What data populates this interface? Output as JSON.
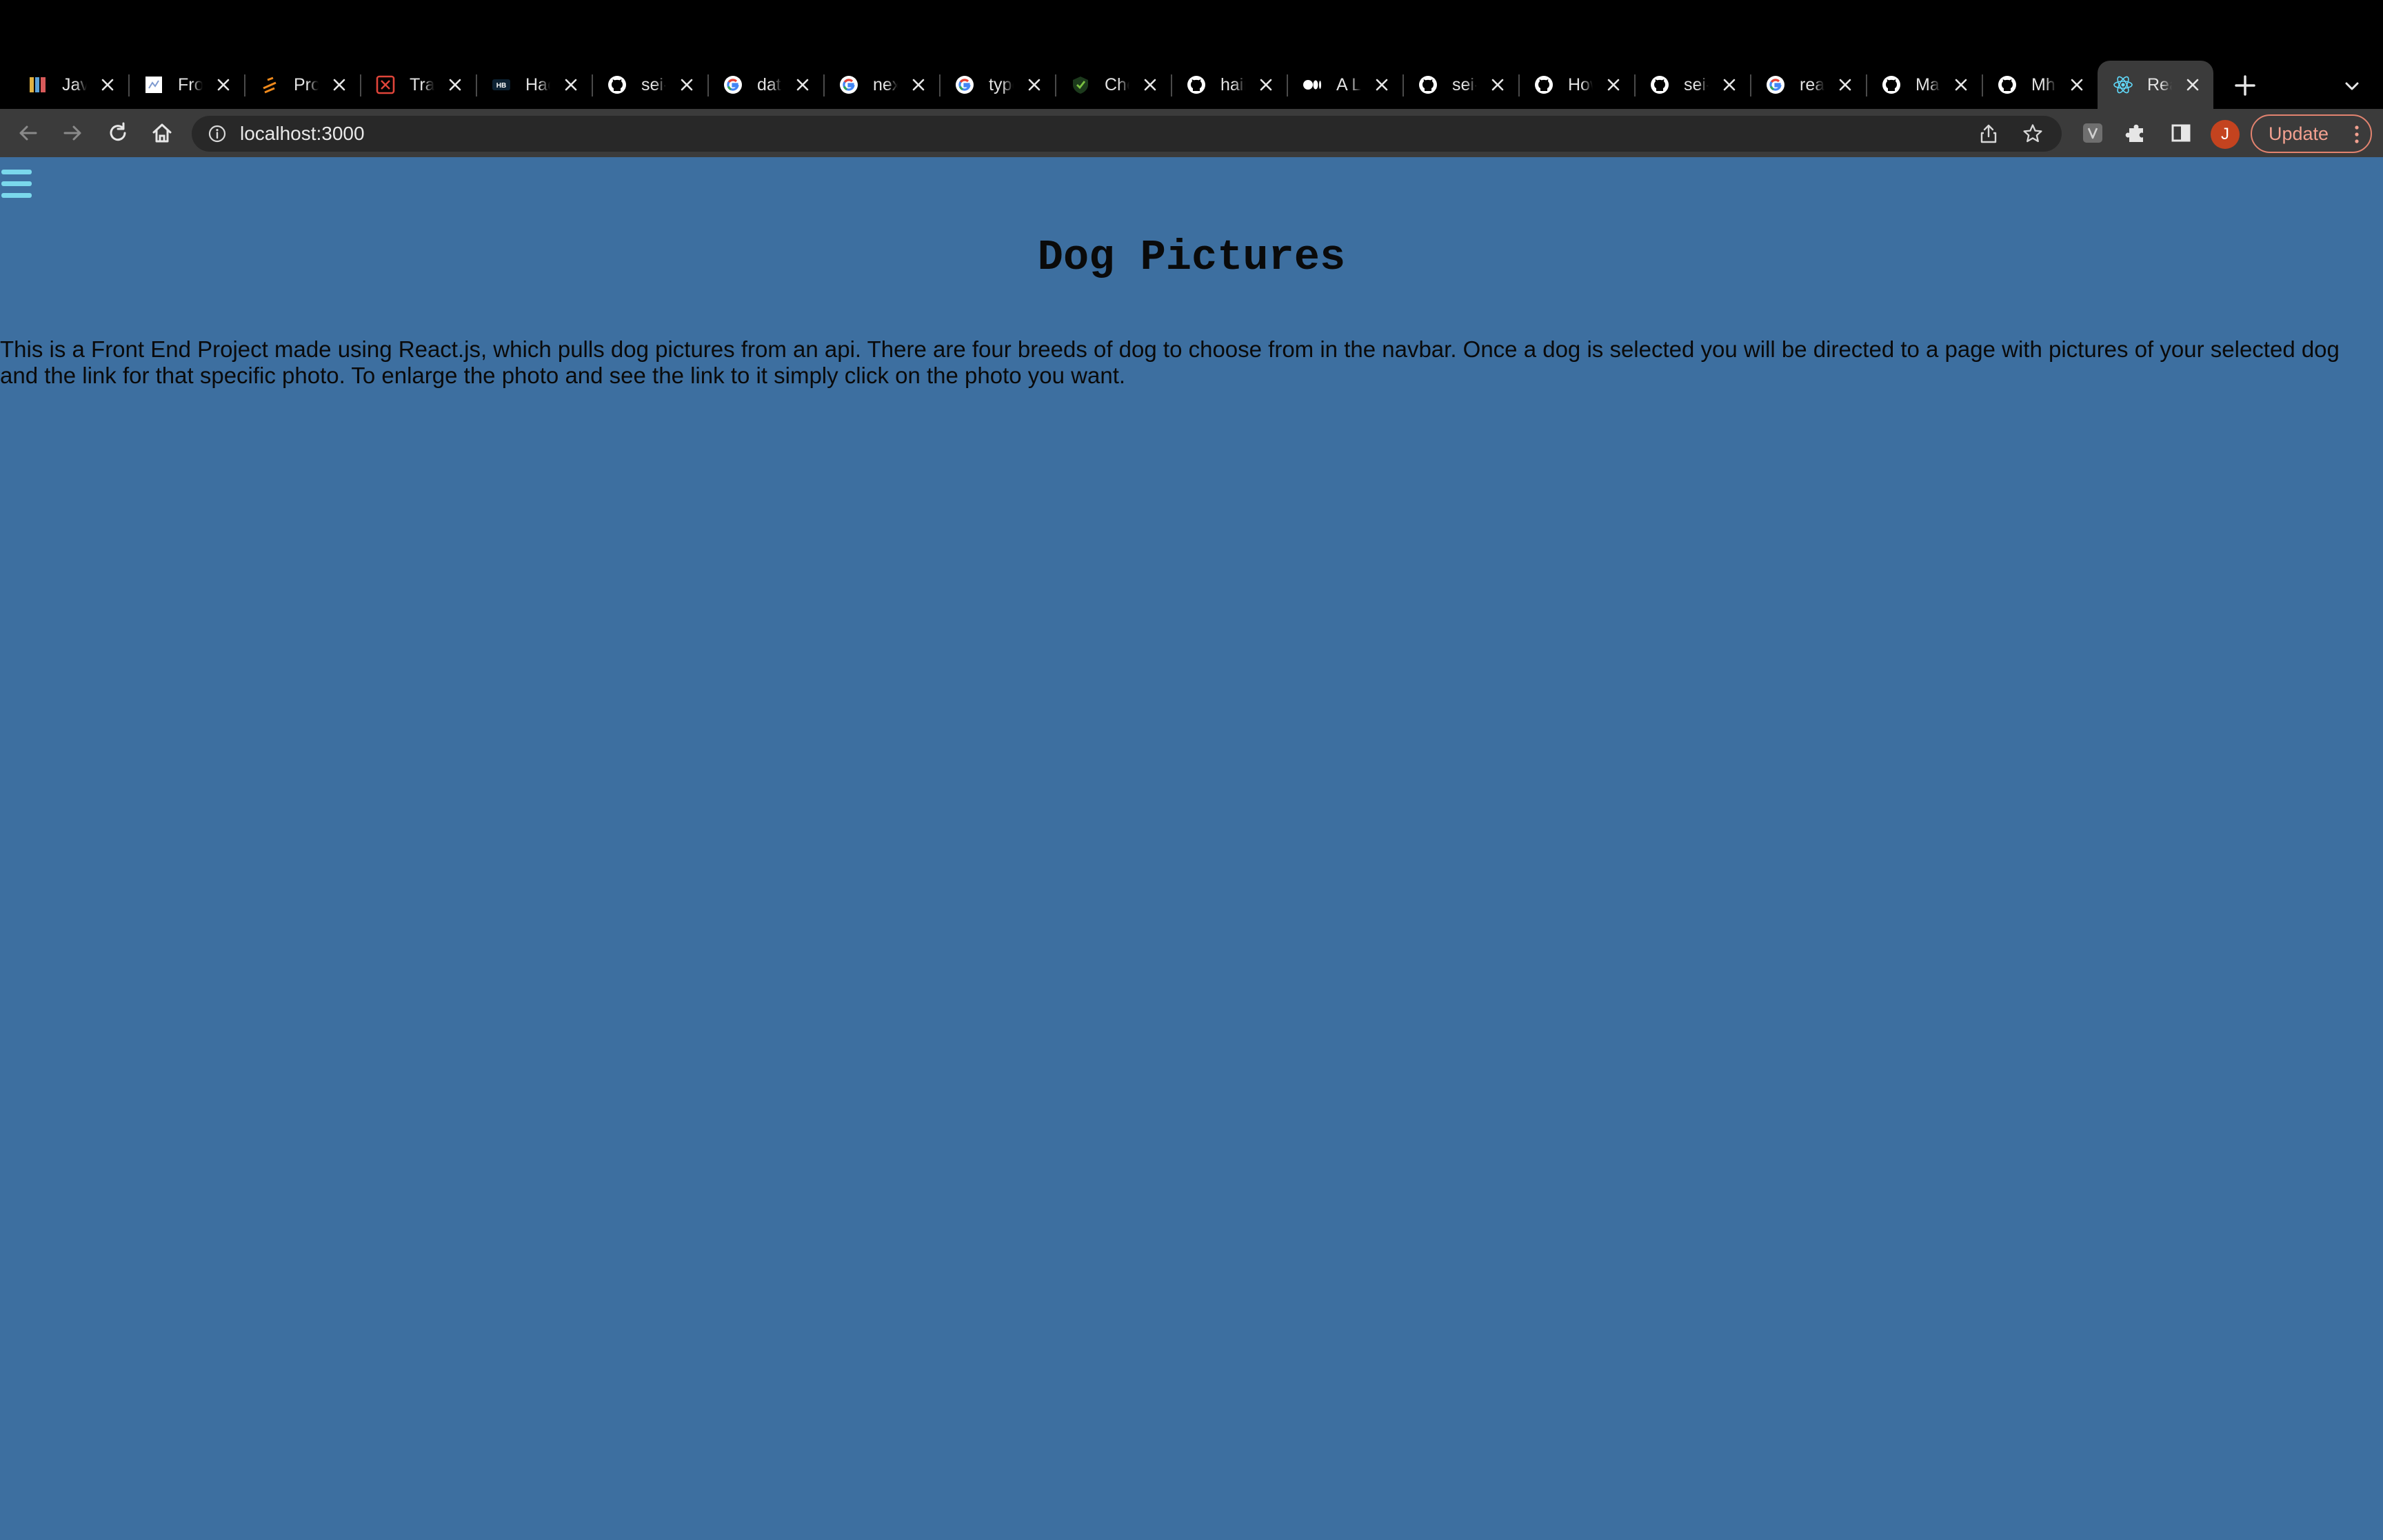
{
  "browser": {
    "tabs": [
      {
        "title": "JavaScript",
        "favicon": "books-icon",
        "accent": "#e0b040"
      },
      {
        "title": "Front",
        "favicon": "document-icon",
        "accent": "#ffffff"
      },
      {
        "title": "Project",
        "favicon": "spark-icon",
        "accent": "#f08a1c"
      },
      {
        "title": "Trail",
        "favicon": "trail-icon",
        "accent": "#e0453a"
      },
      {
        "title": "Hacker",
        "favicon": "hashnode-icon",
        "accent": "#4fc3f7"
      },
      {
        "title": "sei-",
        "favicon": "github-icon",
        "accent": "#ffffff"
      },
      {
        "title": "data",
        "favicon": "google-icon",
        "accent": "#4285f4"
      },
      {
        "title": "next",
        "favicon": "google-icon",
        "accent": "#4285f4"
      },
      {
        "title": "type",
        "favicon": "google-icon",
        "accent": "#4285f4"
      },
      {
        "title": "Chec",
        "favicon": "shield-icon",
        "accent": "#7bc142"
      },
      {
        "title": "hair",
        "favicon": "github-icon",
        "accent": "#ffffff"
      },
      {
        "title": "A Li",
        "favicon": "medium-icon",
        "accent": "#ffffff"
      },
      {
        "title": "sei-",
        "favicon": "github-icon",
        "accent": "#ffffff"
      },
      {
        "title": "How",
        "favicon": "github-icon",
        "accent": "#ffffff"
      },
      {
        "title": "sei-",
        "favicon": "github-icon",
        "accent": "#ffffff"
      },
      {
        "title": "react",
        "favicon": "google-icon",
        "accent": "#4285f4"
      },
      {
        "title": "Man",
        "favicon": "github-icon",
        "accent": "#ffffff"
      },
      {
        "title": "Mha",
        "favicon": "github-icon",
        "accent": "#ffffff"
      },
      {
        "title": "React",
        "favicon": "react-icon",
        "accent": "#61dafb",
        "active": true
      }
    ],
    "url": "localhost:3000",
    "profile_initial": "J",
    "update_label": "Update"
  },
  "page": {
    "title": "Dog Pictures",
    "description": "This is a Front End Project made using React.js, which pulls dog pictures from an api. There are four breeds of dog to choose from in the navbar. Once a dog is selected you will be directed to a page with pictures of your selected dog and the link for that specific photo. To enlarge the photo and see the link to it simply click on the photo you want."
  },
  "colors": {
    "page_background": "#3d6fa0",
    "hamburger": "#7ad8ec",
    "tabstrip": "#000000",
    "toolbar": "#3b3b3b"
  }
}
